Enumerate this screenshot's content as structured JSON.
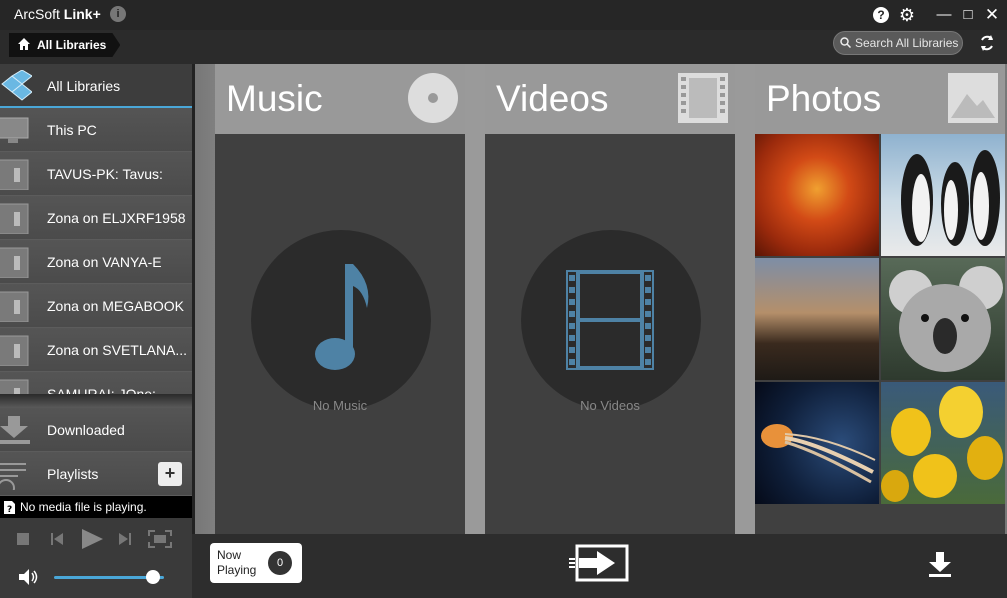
{
  "app": {
    "title_prefix": "ArcSoft",
    "title_bold": "Link+"
  },
  "window_controls": {
    "help": "?",
    "minimize": "—",
    "maximize": "□",
    "close": "✕"
  },
  "breadcrumb": {
    "label": "All Libraries"
  },
  "search": {
    "placeholder": "Search All Libraries"
  },
  "sidebar": {
    "items": [
      {
        "label": "All Libraries",
        "icon": "boxes-icon"
      },
      {
        "label": "This PC",
        "icon": "monitor-icon"
      },
      {
        "label": "TAVUS-PK: Tavus:",
        "icon": "server-icon"
      },
      {
        "label": "Zona on ELJXRF1958",
        "icon": "server-icon"
      },
      {
        "label": "Zona on VANYA-E",
        "icon": "server-icon"
      },
      {
        "label": "Zona on MEGABOOK",
        "icon": "server-icon"
      },
      {
        "label": "Zona on SVETLANA...",
        "icon": "server-icon"
      },
      {
        "label": "SAMURAI: JOne:",
        "icon": "server-icon"
      }
    ],
    "downloaded": "Downloaded",
    "playlists": "Playlists",
    "add_label": "+"
  },
  "player": {
    "status": "No media file is playing.",
    "volume": 0.9
  },
  "panels": {
    "music": {
      "title": "Music",
      "empty": "No Music"
    },
    "videos": {
      "title": "Videos",
      "empty": "No Videos"
    },
    "photos": {
      "title": "Photos"
    }
  },
  "now_playing": {
    "line1": "Now",
    "line2": "Playing",
    "count": "0"
  },
  "colors": {
    "accent": "#4aa7d8",
    "music_note": "#4e82a5"
  }
}
